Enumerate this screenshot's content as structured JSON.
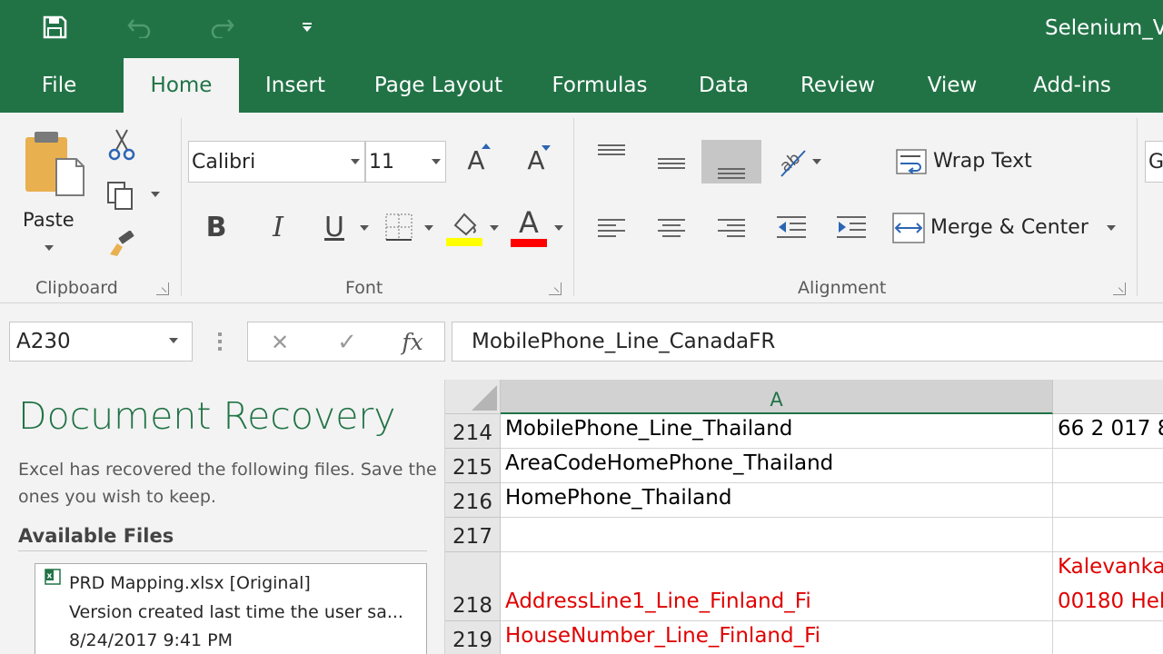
{
  "window": {
    "title": "Selenium_Va"
  },
  "tabs": [
    "File",
    "Home",
    "Insert",
    "Page Layout",
    "Formulas",
    "Data",
    "Review",
    "View",
    "Add-ins"
  ],
  "active_tab": "Home",
  "ribbon": {
    "clipboard": {
      "paste_label": "Paste",
      "group_label": "Clipboard"
    },
    "font": {
      "name": "Calibri",
      "size": "11",
      "bold": "B",
      "italic": "I",
      "underline": "U",
      "font_color_glyph": "A",
      "grow_glyph": "A",
      "shrink_glyph": "A",
      "group_label": "Font",
      "highlight_color": "#ffff00",
      "font_color": "#ff0000"
    },
    "alignment": {
      "wrap_text": "Wrap Text",
      "merge_center": "Merge & Center",
      "group_label": "Alignment"
    },
    "next_group_partial": "G"
  },
  "formula_bar": {
    "name_box": "A230",
    "cancel": "✕",
    "enter": "✓",
    "fx": "fx",
    "formula": "MobilePhone_Line_CanadaFR"
  },
  "recovery": {
    "title": "Document Recovery",
    "description": "Excel has recovered the following files.  Save the ones you wish to keep.",
    "available_label": "Available Files",
    "files": [
      {
        "name": "PRD Mapping.xlsx  [Original]",
        "detail": "Version created last time the user sa...",
        "timestamp": "8/24/2017 9:41 PM"
      }
    ]
  },
  "grid": {
    "columns": [
      "A"
    ],
    "rows": [
      {
        "num": "214",
        "a": "MobilePhone_Line_Thailand",
        "b": "66 2 017 8",
        "red": false
      },
      {
        "num": "215",
        "a": "AreaCodeHomePhone_Thailand",
        "b": "",
        "red": false
      },
      {
        "num": "216",
        "a": "HomePhone_Thailand",
        "b": "",
        "red": false
      },
      {
        "num": "217",
        "a": "",
        "b": "",
        "red": false
      },
      {
        "num": "218",
        "a": "AddressLine1_Line_Finland_Fi",
        "b_line1": "Kalevanka",
        "b": "00180 Hel",
        "red": true
      },
      {
        "num": "219",
        "a": "HouseNumber_Line_Finland_Fi",
        "b": "",
        "red": true
      }
    ]
  }
}
